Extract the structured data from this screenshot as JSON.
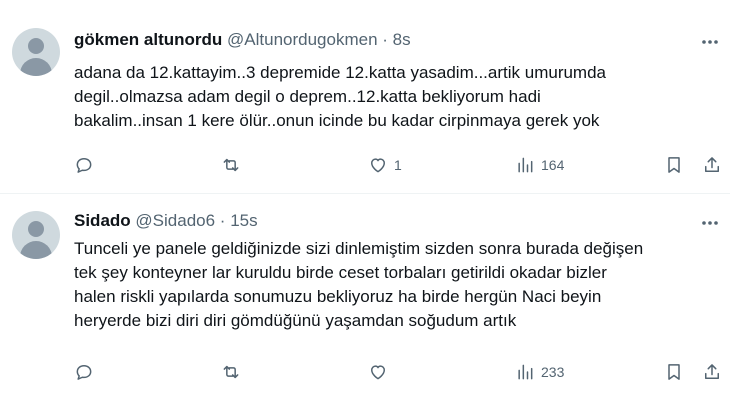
{
  "tweets": [
    {
      "author_name": "gökmen altunordu",
      "handle": "@Altunordugokmen",
      "separator": "·",
      "time": "8s",
      "text": "adana da 12.kattayim..3 depremide 12.katta yasadim...artik umurumda degil..olmazsa adam degil o deprem..12.katta bekliyorum hadi bakalim..insan 1 kere ölür..onun icinde bu kadar cirpinmaya gerek yok",
      "lines": [
        "adana da 12.kattayim..3 depremide 12.katta yasadim...artik umurumda",
        "degil..olmazsa adam degil o deprem..12.katta bekliyorum hadi",
        "bakalim..insan 1 kere ölür..onun icinde bu kadar cirpinmaya gerek yok"
      ],
      "replies": "",
      "retweets": "",
      "likes": "1",
      "views": "164"
    },
    {
      "author_name": "Sidado",
      "handle": "@Sidado6",
      "separator": "·",
      "time": "15s",
      "lines": [
        "Tunceli ye panele geldiğinizde sizi dinlemiştim sizden sonra burada değişen",
        "tek şey konteyner lar kuruldu birde ceset torbaları getirildi okadar bizler",
        "halen riskli yapılarda sonumuzu bekliyoruz ha birde hergün Naci beyin",
        "heryerde bizi diri diri gömdüğünü yaşamdan soğudum artık"
      ],
      "replies": "",
      "retweets": "",
      "likes": "",
      "views": "233"
    }
  ],
  "icons": {
    "more": "more-horizontal-icon",
    "reply": "reply-icon",
    "retweet": "retweet-icon",
    "like": "heart-icon",
    "views": "views-chart-icon",
    "bookmark": "bookmark-icon",
    "share": "share-icon"
  },
  "colors": {
    "text": "#0f1419",
    "secondary": "#536471",
    "divider": "#eff3f4",
    "avatar": "#cfd9de"
  }
}
